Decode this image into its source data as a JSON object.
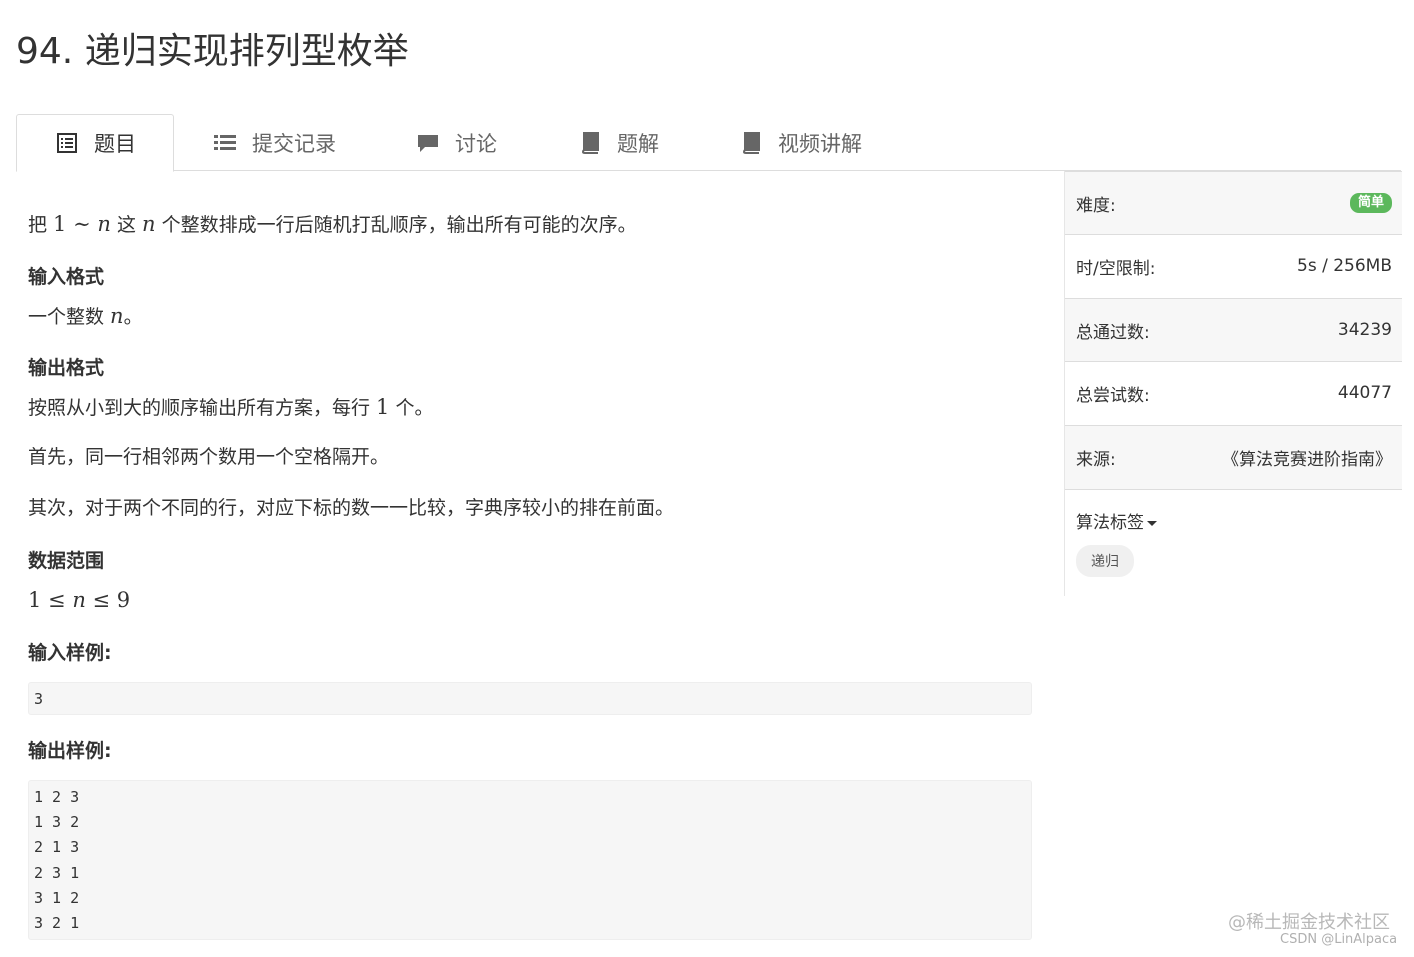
{
  "problem": {
    "title": "94. 递归实现排列型枚举"
  },
  "tabs": [
    {
      "label": "题目",
      "icon": "list-alt-icon",
      "active": true
    },
    {
      "label": "提交记录",
      "icon": "list-icon"
    },
    {
      "label": "讨论",
      "icon": "comment-icon"
    },
    {
      "label": "题解",
      "icon": "book-icon"
    },
    {
      "label": "视频讲解",
      "icon": "book-icon"
    }
  ],
  "description": {
    "p1_a": "把 ",
    "p1_m1": "1",
    "p1_sim": " ∼ ",
    "p1_n1": "n",
    "p1_b": " 这 ",
    "p1_n2": "n",
    "p1_c": " 个整数排成一行后随机打乱顺序，输出所有可能的次序。",
    "input_heading": "输入格式",
    "input_a": "一个整数 ",
    "input_n": "n",
    "input_b": "。",
    "output_heading": "输出格式",
    "out1_a": "按照从小到大的顺序输出所有方案，每行 ",
    "out1_m": "1",
    "out1_b": " 个。",
    "out2": "首先，同一行相邻两个数用一个空格隔开。",
    "out3": "其次，对于两个不同的行，对应下标的数一一比较，字典序较小的排在前面。",
    "range_heading": "数据范围",
    "range_a": "1 ≤ ",
    "range_n": "n",
    "range_b": " ≤ 9",
    "sample_input_heading": "输入样例:",
    "sample_input": [
      "3"
    ],
    "sample_output_heading": "输出样例:",
    "sample_output": [
      "1 2 3",
      "1 3 2",
      "2 1 3",
      "2 3 1",
      "3 1 2",
      "3 2 1"
    ]
  },
  "sidebar": {
    "difficulty_label": "难度:",
    "difficulty_value": "简单",
    "difficulty_color": "#5cb85c",
    "limit_label": "时/空限制:",
    "limit_value": "5s / 256MB",
    "accepted_label": "总通过数:",
    "accepted_value": "34239",
    "attempts_label": "总尝试数:",
    "attempts_value": "44077",
    "source_label": "来源:",
    "source_value": "《算法竞赛进阶指南》",
    "tags_label": "算法标签",
    "tag": "递归"
  },
  "watermark": {
    "line1": "@稀土掘金技术社区",
    "line2": "CSDN @LinAlpaca"
  }
}
